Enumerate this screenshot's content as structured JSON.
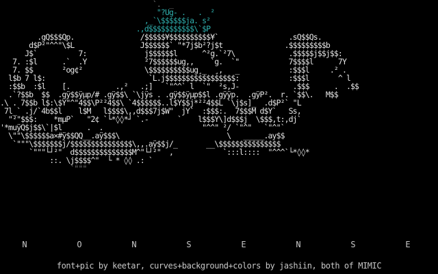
{
  "art": {
    "lines": [
      {
        "text": "                                     `.  _                                   ",
        "tone": "d"
      },
      {
        "text": "                                      \"?Ug- .   .  ²                          ",
        "tone": "c"
      },
      {
        "text": "                                   ,_`\\$$$$$$ja. s²                          ",
        "tone": "c"
      },
      {
        "text": "                                 .,d$$$$$$$$$$$\\`$P                          ",
        "tone": "c"
      },
      {
        "text": "         .gQ$$$Qp.                /$$$$$¥$$$$$$$$$$¥`                 .sQ$$Qs. ",
        "tone": "w"
      },
      {
        "text": "       d$P²\"^^\"\\$L                J$$$$$$` \"*7j$b²?j$t               .$$$$$$$$$b",
        "tone": "w"
      },
      {
        "text": "      J$`          7:              j$$$$$$l      ^²g.`²7\\             .$$$$$j$$j$$:",
        "tone": "w"
      },
      {
        "text": "   7. :$l      .`  .Y              ²7$$$$$$ug,,    `g.  `\"            7$$$$l      7Y",
        "tone": "w"
      },
      {
        "text": "   7. $$       ²og¢²               \\$$$$$$$$$$ug¸_  ¸,   _            :$$$l     .² .",
        "tone": "w"
      },
      {
        "text": "  l$b 7 l$:                         `L.j$$$$$$$$$$$$$$$$$:            :$$$l       ^ l",
        "tone": "w"
      },
      {
        "text": "  :$$b  :$l    [.           .,²   .;]   `\"^^` l  `\"  ²s,J-             .$$$      .  .$$",
        "tone": "w"
      },
      {
        "text": "  .`?$$b  $$  .gÿ$$ÿµp/# .gÿ$$\\ `\\jÿs . .gÿ$$ÿµp$$l .gÿÿp.  .gÿP².  r. `$$\\.   M$$",
        "tone": "w"
      },
      {
        "text": ".\\ . 7$$b l$:\\$Y\"^\"4$$\\P²²4$$\\ `4$$$$$$..l$Y$$j*²²4$$L `\\j$s]_  .d$P²` \"L",
        "tone": "w"
      },
      {
        "text": " 7l_` .j/`4b$$l    l$M   l$$$$\\,,d$$$7j$W\"  jY`  :$$$:.  7$$$M d$Y`   Ss,",
        "tone": "w"
      },
      {
        "text": "  \"²\"$$$:    *mµP`   \"2¢ `└*◊◊*┘ `.-       `    l$$$Y\\]d$$$j  \\$$$,t:,dj` ",
        "tone": "w"
      },
      {
        "text": "'*muÿQ$j$$\\`|$l      .  .                        \"^^\" ²/ `\"^\"   `\"^\"`",
        "tone": "w"
      },
      {
        "text": "  \\\"\"\\$$$$$$a×#ÿ$$QQ__.aÿ$$$\\                          \\   _____.ay$$",
        "tone": "w"
      },
      {
        "text": "   `\"\"\"\\$$$$$$$j/$$$$$$$$$$$$$$$\\,,.aÿ$$j/_       __\\$$$$$$$$$$$$$$$",
        "tone": "w"
      },
      {
        "text": "       `\"\"\"└┘²\"  d$$$$$$$$$$$$$$M^\"└┘²\"  ,            `:::l::::  \"^^^`└*◊◊*",
        "tone": "w"
      },
      {
        "text": "            ::. \\j$$$$^\"  └ * ◊◊ .: `                                    ",
        "tone": "w"
      },
      {
        "text": "                 `\"\"\"                                                   ",
        "tone": "d"
      }
    ],
    "title_letters": [
      "N",
      "O",
      "N",
      "S",
      "E",
      "N",
      "S",
      "E"
    ],
    "credits": "font+pic by keetar, curves+background+colors by jashiin, both of MIMIC"
  },
  "colors": {
    "background": "#000000",
    "text_white": "#e6e6e6",
    "text_grey": "#b8b8b8",
    "accent_cyan": "#2fb0ae",
    "accent_green": "#46c24a",
    "accent_red": "#d02020",
    "dim_grey": "#7a7a7a"
  }
}
